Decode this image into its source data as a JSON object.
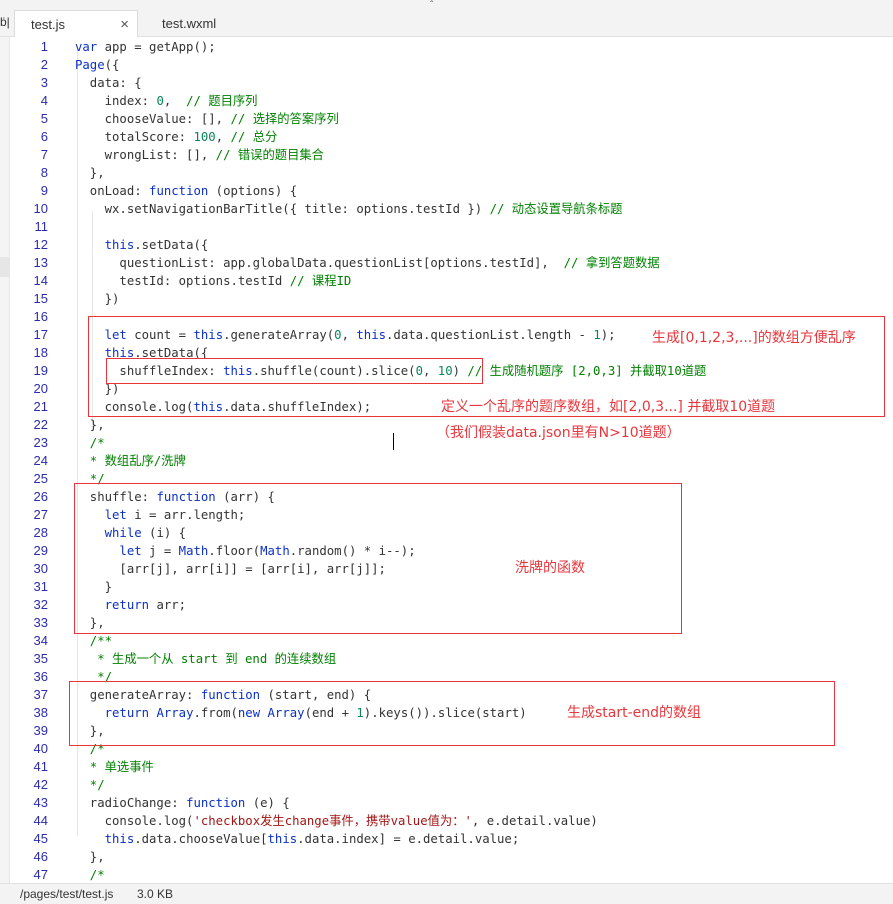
{
  "tabs": [
    {
      "label": "test.js",
      "active": true
    },
    {
      "label": "test.wxml",
      "active": false
    }
  ],
  "tab_close_glyph": "×",
  "left_stub": "ḃ|",
  "top_mark": "ˆ",
  "code_lines": [
    {
      "num": "1",
      "text": "var app = getApp();"
    },
    {
      "num": "2",
      "text": "Page({"
    },
    {
      "num": "3",
      "text": "  data: {"
    },
    {
      "num": "4",
      "text": "    index: 0,  // 题目序列"
    },
    {
      "num": "5",
      "text": "    chooseValue: [], // 选择的答案序列"
    },
    {
      "num": "6",
      "text": "    totalScore: 100, // 总分"
    },
    {
      "num": "7",
      "text": "    wrongList: [], // 错误的题目集合"
    },
    {
      "num": "8",
      "text": "  },"
    },
    {
      "num": "9",
      "text": "  onLoad: function (options) {"
    },
    {
      "num": "10",
      "text": "    wx.setNavigationBarTitle({ title: options.testId }) // 动态设置导航条标题"
    },
    {
      "num": "11",
      "text": ""
    },
    {
      "num": "12",
      "text": "    this.setData({"
    },
    {
      "num": "13",
      "text": "      questionList: app.globalData.questionList[options.testId],  // 拿到答题数据"
    },
    {
      "num": "14",
      "text": "      testId: options.testId // 课程ID"
    },
    {
      "num": "15",
      "text": "    })"
    },
    {
      "num": "16",
      "text": ""
    },
    {
      "num": "17",
      "text": "    let count = this.generateArray(0, this.data.questionList.length - 1);"
    },
    {
      "num": "18",
      "text": "    this.setData({"
    },
    {
      "num": "19",
      "text": "      shuffleIndex: this.shuffle(count).slice(0, 10) // 生成随机题序 [2,0,3] 并截取10道题"
    },
    {
      "num": "20",
      "text": "    })"
    },
    {
      "num": "21",
      "text": "    console.log(this.data.shuffleIndex);"
    },
    {
      "num": "22",
      "text": "  },"
    },
    {
      "num": "23",
      "text": "  /*"
    },
    {
      "num": "24",
      "text": "  * 数组乱序/洗牌"
    },
    {
      "num": "25",
      "text": "  */"
    },
    {
      "num": "26",
      "text": "  shuffle: function (arr) {"
    },
    {
      "num": "27",
      "text": "    let i = arr.length;"
    },
    {
      "num": "28",
      "text": "    while (i) {"
    },
    {
      "num": "29",
      "text": "      let j = Math.floor(Math.random() * i--);"
    },
    {
      "num": "30",
      "text": "      [arr[j], arr[i]] = [arr[i], arr[j]];"
    },
    {
      "num": "31",
      "text": "    }"
    },
    {
      "num": "32",
      "text": "    return arr;"
    },
    {
      "num": "33",
      "text": "  },"
    },
    {
      "num": "34",
      "text": "  /**"
    },
    {
      "num": "35",
      "text": "   * 生成一个从 start 到 end 的连续数组"
    },
    {
      "num": "36",
      "text": "   */"
    },
    {
      "num": "37",
      "text": "  generateArray: function (start, end) {"
    },
    {
      "num": "38",
      "text": "    return Array.from(new Array(end + 1).keys()).slice(start)"
    },
    {
      "num": "39",
      "text": "  },"
    },
    {
      "num": "40",
      "text": "  /*"
    },
    {
      "num": "41",
      "text": "  * 单选事件"
    },
    {
      "num": "42",
      "text": "  */"
    },
    {
      "num": "43",
      "text": "  radioChange: function (e) {"
    },
    {
      "num": "44",
      "text": "    console.log('checkbox发生change事件，携带value值为：', e.detail.value)"
    },
    {
      "num": "45",
      "text": "    this.data.chooseValue[this.data.index] = e.detail.value;"
    },
    {
      "num": "46",
      "text": "  },"
    },
    {
      "num": "47",
      "text": "  /*"
    }
  ],
  "annotations": {
    "array_note": "生成[0,1,2,3,...]的数组方便乱序",
    "shuffle_note_1": "定义一个乱序的题序数组，如[2,0,3...] 并截取10道题",
    "shuffle_note_2": "（我们假装data.json里有N>10道题）",
    "shuffle_fn_note": "洗牌的函数",
    "generate_fn_note": "生成start-end的数组"
  },
  "status": {
    "path": "/pages/test/test.js",
    "size": "3.0 KB"
  },
  "colors": {
    "annotation_red": "#e8363c",
    "line_number_blue": "#2b2bb0",
    "keyword_blue": "#0b30c7",
    "comment_green": "#008000",
    "number_green": "#098658",
    "string_red": "#a31515"
  }
}
